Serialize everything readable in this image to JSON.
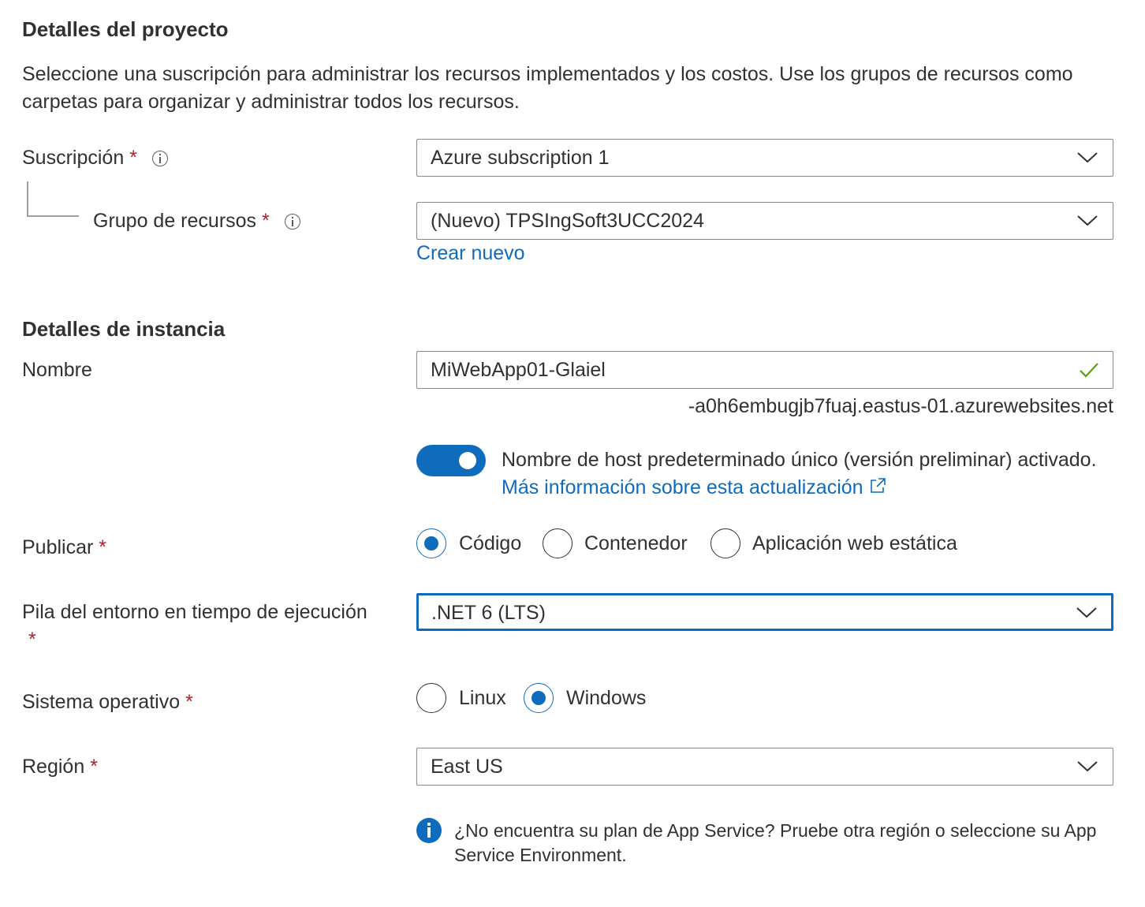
{
  "project": {
    "title": "Detalles del proyecto",
    "description": "Seleccione una suscripción para administrar los recursos implementados y los costos. Use los grupos de recursos como carpetas para organizar y administrar todos los recursos."
  },
  "subscription": {
    "label": "Suscripción",
    "required": "*",
    "value": "Azure subscription 1"
  },
  "resource_group": {
    "label": "Grupo de recursos",
    "required": "*",
    "value": "(Nuevo) TPSIngSoft3UCC2024",
    "create_new": "Crear nuevo"
  },
  "instance": {
    "title": "Detalles de instancia"
  },
  "name": {
    "label": "Nombre",
    "value": "MiWebApp01-Glaiel",
    "suffix": "-a0h6embugjb7fuaj.eastus-01.azurewebsites.net"
  },
  "hostname_toggle": {
    "on": true,
    "text": "Nombre de host predeterminado único (versión preliminar) activado.",
    "link": "Más información sobre esta actualización"
  },
  "publish": {
    "label": "Publicar",
    "required": "*",
    "options": [
      "Código",
      "Contenedor",
      "Aplicación web estática"
    ],
    "selected": "Código"
  },
  "runtime": {
    "label": "Pila del entorno en tiempo de ejecución",
    "required": "*",
    "value": ".NET 6 (LTS)"
  },
  "os": {
    "label": "Sistema operativo",
    "required": "*",
    "options": [
      "Linux",
      "Windows"
    ],
    "selected": "Windows"
  },
  "region": {
    "label": "Región",
    "required": "*",
    "value": "East US",
    "info": "¿No encuentra su plan de App Service? Pruebe otra región o seleccione su App Service Environment."
  },
  "colors": {
    "accent": "#0f6cbd",
    "required": "#a4262c",
    "valid": "#57a300"
  }
}
